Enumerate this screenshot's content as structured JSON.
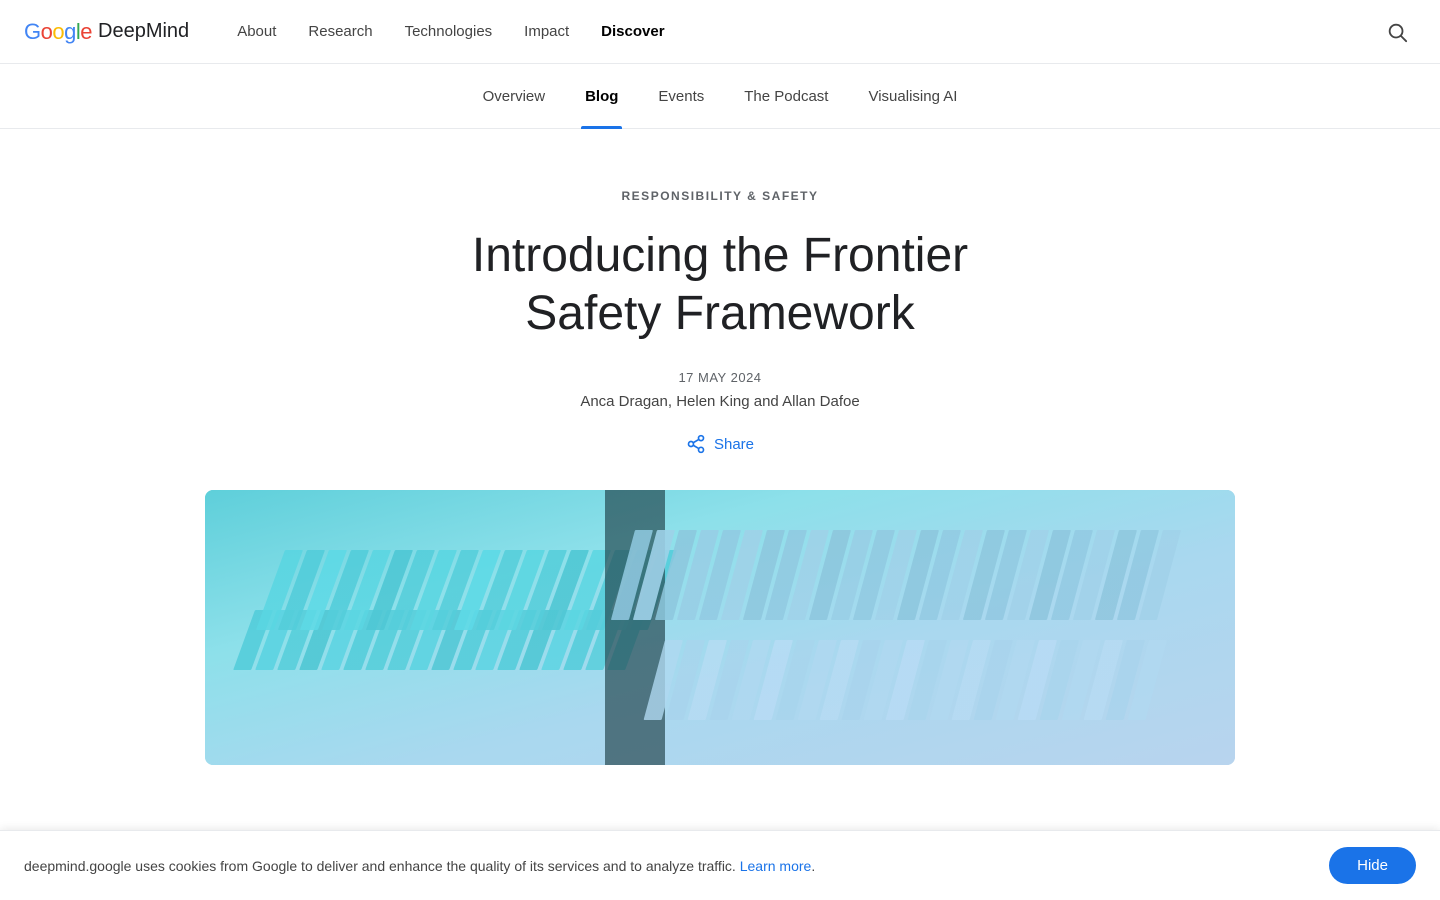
{
  "logo": {
    "google": "Google",
    "deepmind": "DeepMind"
  },
  "nav": {
    "items": [
      {
        "label": "About",
        "active": false
      },
      {
        "label": "Research",
        "active": false
      },
      {
        "label": "Technologies",
        "active": false
      },
      {
        "label": "Impact",
        "active": false
      },
      {
        "label": "Discover",
        "active": true
      }
    ],
    "search_label": "Search"
  },
  "subnav": {
    "items": [
      {
        "label": "Overview",
        "active": false
      },
      {
        "label": "Blog",
        "active": true
      },
      {
        "label": "Events",
        "active": false
      },
      {
        "label": "The Podcast",
        "active": false
      },
      {
        "label": "Visualising AI",
        "active": false
      }
    ]
  },
  "article": {
    "category": "RESPONSIBILITY & SAFETY",
    "title": "Introducing the Frontier Safety Framework",
    "date": "17 MAY 2024",
    "authors": "Anca Dragan, Helen King and Allan Dafoe",
    "share_label": "Share"
  },
  "cookie": {
    "text": "deepmind.google uses cookies from Google to deliver and enhance the quality of its services and to analyze traffic.",
    "learn_more": "Learn more",
    "hide_label": "Hide"
  },
  "colors": {
    "accent": "#1a73e8",
    "active_underline": "#1a73e8"
  }
}
